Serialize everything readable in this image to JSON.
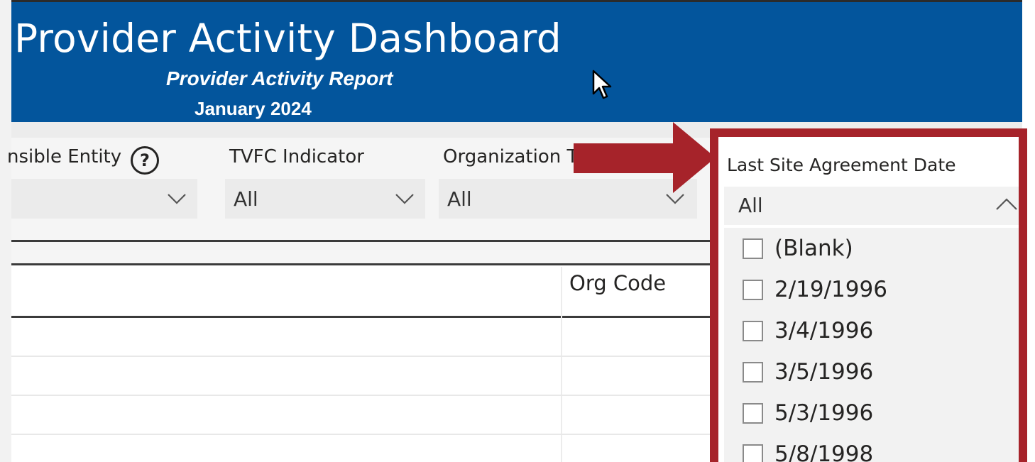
{
  "header": {
    "title": "Provider Activity Dashboard",
    "subtitle": "Provider Activity Report",
    "report_date": "January 2024"
  },
  "slicers": [
    {
      "label": "nsible Entity",
      "value": ""
    },
    {
      "label": "TVFC Indicator",
      "value": "All"
    },
    {
      "label": "Organization T",
      "value": "All"
    }
  ],
  "dropdown": {
    "label": "Last Site Agreement Date",
    "selected": "All",
    "options": [
      "(Blank)",
      "2/19/1996",
      "3/4/1996",
      "3/5/1996",
      "5/3/1996",
      "5/8/1998"
    ]
  },
  "table": {
    "columns": [
      "",
      "Org Code"
    ]
  },
  "colors": {
    "header_bg": "#03559c",
    "highlight_border": "#a6232a",
    "arrow": "#a6232a"
  },
  "icons": [
    "help-icon",
    "chevron-down-icon",
    "chevron-up-icon",
    "mouse-cursor-icon",
    "checkbox-icon",
    "arrow-right-icon"
  ]
}
